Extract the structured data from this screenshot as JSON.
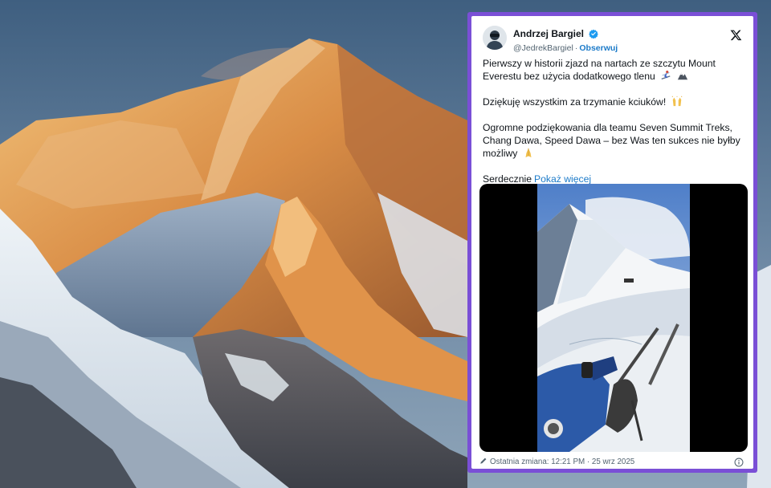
{
  "tweet": {
    "author_name": "Andrzej Bargiel",
    "handle": "@JedrekBargiel",
    "separator": "·",
    "follow_label": "Obserwuj",
    "paragraph_1": "Pierwszy w historii zjazd na nartach ze szczytu Mount Everestu bez użycia dodatkowego tlenu",
    "paragraph_2": "Dziękuję wszystkim za trzymanie kciuków!",
    "paragraph_3": "Ogromne podziękowania dla teamu Seven Summit Treks, Chang Dawa, Speed Dawa – bez Was ten sukces nie byłby możliwy",
    "paragraph_4": "Serdecznie",
    "show_more_label": "Pokaż więcej",
    "footer_text": "Ostatnia zmiana: 12:21 PM · 25 wrz 2025",
    "accent_color": "#1d9bf0",
    "frame_color": "#7a4fd6"
  },
  "icons": {
    "verified": "verified-badge-icon",
    "close": "x-logo-icon",
    "skier_emoji": "skier-icon",
    "mountain_emoji": "mountain-icon",
    "raised_hands_emoji": "raised-hands-icon",
    "folded_hands_emoji": "folded-hands-icon",
    "edit": "pencil-icon",
    "info": "info-icon"
  }
}
